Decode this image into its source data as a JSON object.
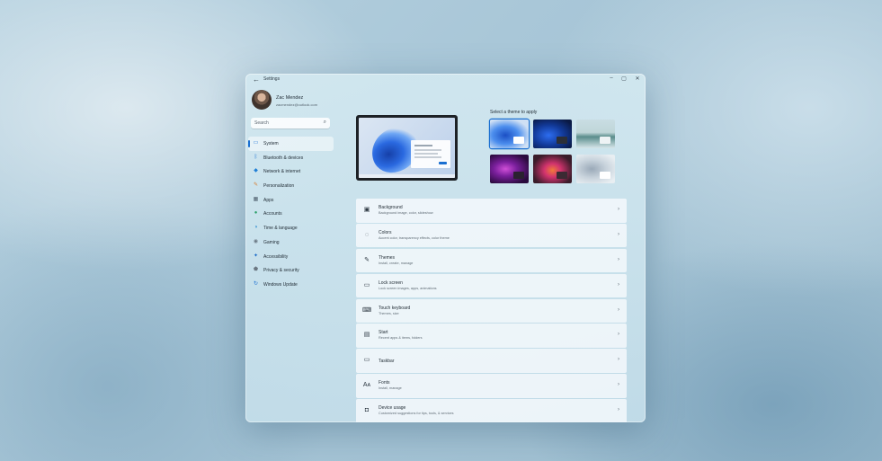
{
  "window": {
    "title": "Settings",
    "back_icon": "←",
    "controls": {
      "minimize": "–",
      "maximize": "▢",
      "close": "✕"
    }
  },
  "profile": {
    "name": "Zac Mendez",
    "email": "zacmendez@outlook.com"
  },
  "search": {
    "placeholder": "Search",
    "icon": "⌕"
  },
  "sidebar": {
    "items": [
      {
        "label": "System",
        "icon": "▭",
        "color": "#2a7ad8",
        "active": true
      },
      {
        "label": "Bluetooth & devices",
        "icon": "ᛒ",
        "color": "#1a6fd1"
      },
      {
        "label": "Network & internet",
        "icon": "◆",
        "color": "#1f7fd6"
      },
      {
        "label": "Personalization",
        "icon": "✎",
        "color": "#d77b2d"
      },
      {
        "label": "Apps",
        "icon": "▦",
        "color": "#4a5a69"
      },
      {
        "label": "Accounts",
        "icon": "●",
        "color": "#2ea06b"
      },
      {
        "label": "Time & language",
        "icon": "◑",
        "color": "#2f8fd0"
      },
      {
        "label": "Gaming",
        "icon": "◉",
        "color": "#6c7a86"
      },
      {
        "label": "Accessibility",
        "icon": "✦",
        "color": "#1b6bc8"
      },
      {
        "label": "Privacy & security",
        "icon": "⬟",
        "color": "#6b7681"
      },
      {
        "label": "Windows Update",
        "icon": "↻",
        "color": "#1a6fd1"
      }
    ]
  },
  "themes": {
    "label": "Select a theme to apply",
    "items": [
      {
        "name": "windows-light",
        "selected": true
      },
      {
        "name": "windows-dark",
        "selected": false
      },
      {
        "name": "glow",
        "selected": false
      },
      {
        "name": "captured-motion",
        "selected": false
      },
      {
        "name": "sunrise",
        "selected": false
      },
      {
        "name": "flow",
        "selected": false
      }
    ]
  },
  "settings": [
    {
      "title": "Background",
      "subtitle": "Background image, color, slideshow",
      "icon": "▣"
    },
    {
      "title": "Colors",
      "subtitle": "Accent color, transparency effects, color theme",
      "icon": "◌"
    },
    {
      "title": "Themes",
      "subtitle": "Install, create, manage",
      "icon": "✎"
    },
    {
      "title": "Lock screen",
      "subtitle": "Lock screen images, apps, animations",
      "icon": "▭"
    },
    {
      "title": "Touch keyboard",
      "subtitle": "Themes, size",
      "icon": "⌨"
    },
    {
      "title": "Start",
      "subtitle": "Recent apps & items, folders",
      "icon": "▤"
    },
    {
      "title": "Taskbar",
      "subtitle": "",
      "icon": "▭"
    },
    {
      "title": "Fonts",
      "subtitle": "Install, manage",
      "icon": "Aᴀ"
    },
    {
      "title": "Device usage",
      "subtitle": "Customized suggestions for tips, tools, & services",
      "icon": "◘"
    }
  ],
  "chevron": "›"
}
